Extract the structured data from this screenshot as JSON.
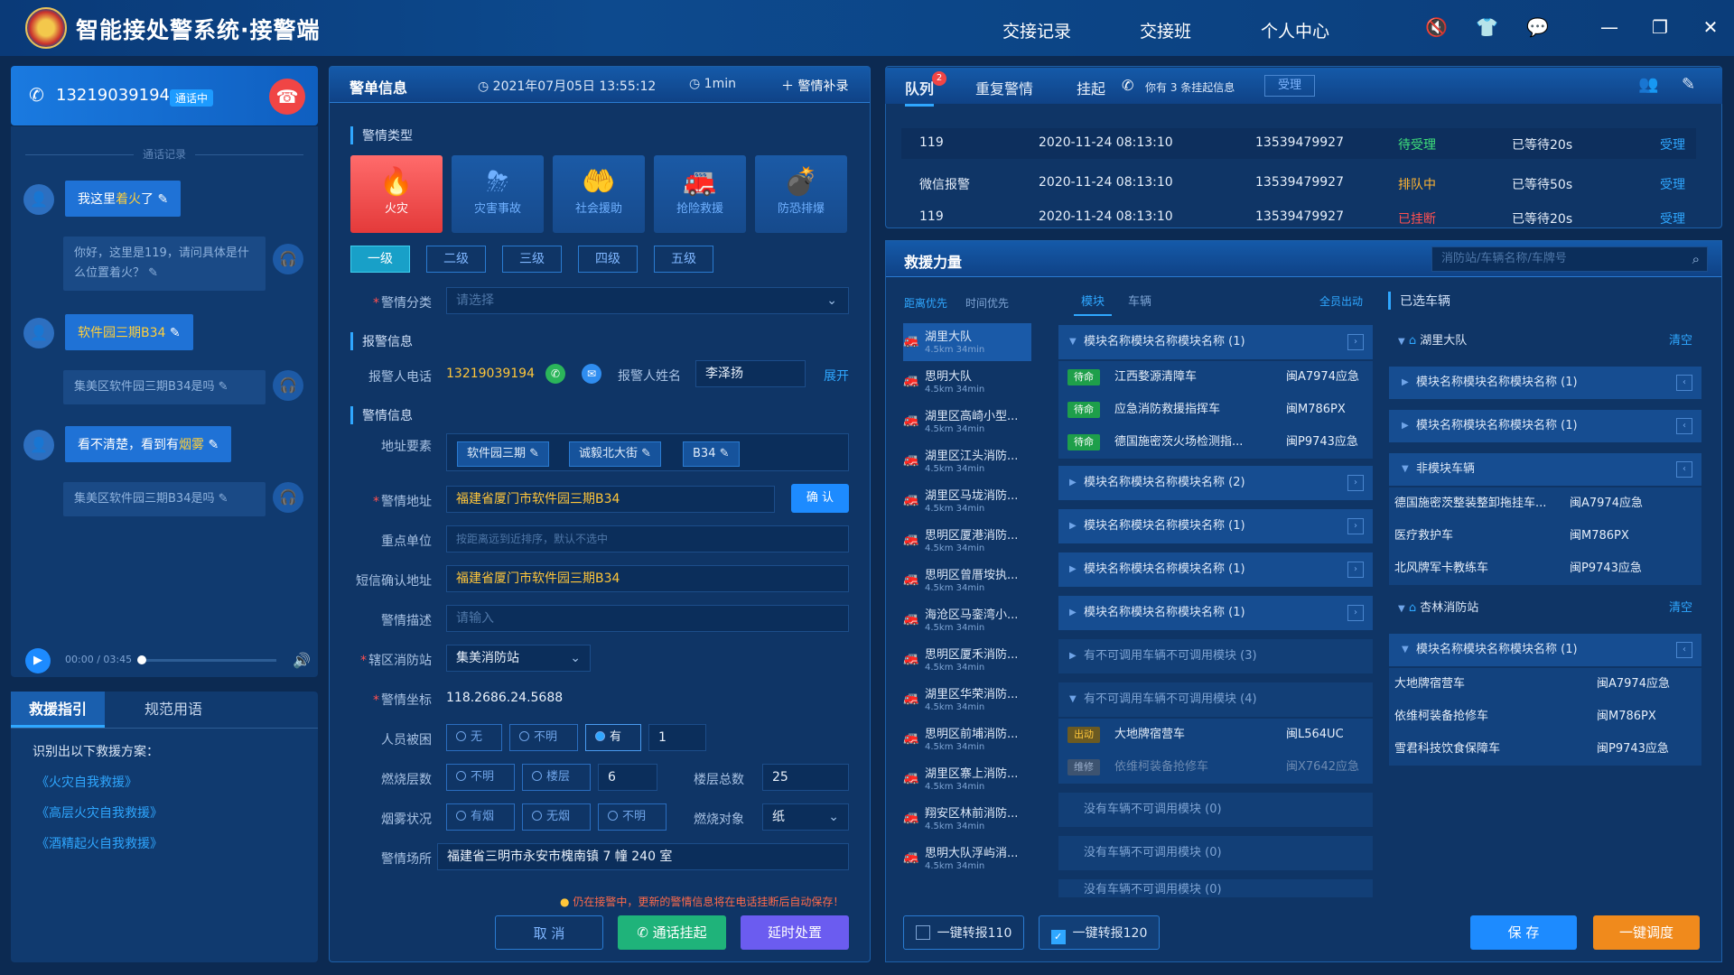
{
  "app": {
    "title": "智能接处警系统·接警端",
    "nav": [
      "交接记录",
      "交接班",
      "个人中心"
    ]
  },
  "call": {
    "phone": "13219039194",
    "status": "通话中",
    "history_label": "通话记录",
    "time": "00:00 / 03:45",
    "messages": [
      {
        "pre": "我这里",
        "hl": "着火",
        "post": "了"
      },
      {
        "text": "你好，这里是119，请问具体是什么位置着火？"
      },
      {
        "pre": "",
        "hl": "软件园三期B34",
        "post": ""
      },
      {
        "text": "集美区软件园三期B34是吗"
      },
      {
        "pre": "看不清楚，看到有",
        "hl": "烟雾",
        "post": ""
      },
      {
        "text": "集美区软件园三期B34是吗"
      }
    ]
  },
  "guide": {
    "tabs": [
      "救援指引",
      "规范用语"
    ],
    "intro": "识别出以下救援方案：",
    "items": [
      "《火灾自我救援》",
      "《高层火灾自我救援》",
      "《酒精起火自我救援》"
    ]
  },
  "form": {
    "title": "警单信息",
    "datetime": "2021年07月05日 13:55:12",
    "duration": "1min",
    "supplement": "警情补录",
    "sec_type": "警情类型",
    "sec_reporter": "报警信息",
    "sec_info": "警情信息",
    "categories": [
      "火灾",
      "灾害事故",
      "社会援助",
      "抢险救援",
      "防恐排爆"
    ],
    "levels": [
      "一级",
      "二级",
      "三级",
      "四级",
      "五级"
    ],
    "class_label": "警情分类",
    "class_ph": "请选择",
    "reporter_phone_label": "报警人电话",
    "reporter_phone": "13219039194",
    "reporter_name_label": "报警人姓名",
    "reporter_name": "李泽扬",
    "expand": "展开",
    "addr_elem_label": "地址要素",
    "addr_tags": [
      "软件园三期",
      "诚毅北大街",
      "B34"
    ],
    "addr_label": "警情地址",
    "addr": "福建省厦门市软件园三期B34",
    "confirm": "确 认",
    "key_unit_label": "重点单位",
    "key_unit_ph": "按距离远到近排序，默认不选中",
    "sms_label": "短信确认地址",
    "sms": "福建省厦门市软件园三期B34",
    "desc_label": "警情描述",
    "desc_ph": "请输入",
    "station_label": "辖区消防站",
    "station": "集美消防站",
    "coord_label": "警情坐标",
    "coord": "118.2686.24.5688",
    "trapped_label": "人员被困",
    "trapped_opts": [
      "无",
      "不明",
      "有"
    ],
    "trapped_count": "1",
    "floor_label": "燃烧层数",
    "floor_opts": [
      "不明",
      "楼层"
    ],
    "floor_val": "6",
    "total_label": "楼层总数",
    "total_val": "25",
    "smoke_label": "烟雾状况",
    "smoke_opts": [
      "有烟",
      "无烟",
      "不明"
    ],
    "burn_label": "燃烧对象",
    "burn_val": "纸",
    "place_label": "警情场所",
    "place": "福建省三明市永安市槐南镇 7 幢 240 室",
    "warning": "仍在接警中，更新的警情信息将在电话挂断后自动保存！",
    "btn_cancel": "取 消",
    "btn_hold": "通话挂起",
    "btn_delay": "延时处置"
  },
  "queue": {
    "tabs": [
      "队列",
      "重复警情",
      "挂起"
    ],
    "badge": "2",
    "hold_info": "你有 3 条挂起信息",
    "accept": "受理",
    "rows": [
      {
        "src": "119",
        "time": "2020-11-24 08:13:10",
        "phone": "13539479927",
        "status": "待受理",
        "wait": "已等待20s",
        "act": "受理",
        "color": "#3fe07a"
      },
      {
        "src": "微信报警",
        "time": "2020-11-24 08:13:10",
        "phone": "13539479927",
        "status": "排队中",
        "wait": "已等待50s",
        "act": "受理",
        "color": "#ffb432"
      },
      {
        "src": "119",
        "time": "2020-11-24 08:13:10",
        "phone": "13539479927",
        "status": "已挂断",
        "wait": "已等待20s",
        "act": "受理",
        "color": "#ff5050"
      }
    ]
  },
  "rescue": {
    "title": "救援力量",
    "search_ph": "消防站/车辆名称/车牌号",
    "sort": [
      "距离优先",
      "时间优先"
    ],
    "tabs": [
      "模块",
      "车辆"
    ],
    "all_out": "全员出动",
    "selected": "已选车辆",
    "stations": [
      {
        "name": "湖里大队",
        "info": "4.5km  34min"
      },
      {
        "name": "思明大队",
        "info": "4.5km  34min"
      },
      {
        "name": "湖里区高崎小型...",
        "info": "4.5km  34min"
      },
      {
        "name": "湖里区江头消防...",
        "info": "4.5km  34min"
      },
      {
        "name": "湖里区马垅消防...",
        "info": "4.5km  34min"
      },
      {
        "name": "思明区厦港消防...",
        "info": "4.5km  34min"
      },
      {
        "name": "思明区曾厝垵执...",
        "info": "4.5km  34min"
      },
      {
        "name": "海沧区马銮湾小...",
        "info": "4.5km  34min"
      },
      {
        "name": "思明区厦禾消防...",
        "info": "4.5km  34min"
      },
      {
        "name": "湖里区华荣消防...",
        "info": "4.5km  34min"
      },
      {
        "name": "思明区前埔消防...",
        "info": "4.5km  34min"
      },
      {
        "name": "湖里区寨上消防...",
        "info": "4.5km  34min"
      },
      {
        "name": "翔安区林前消防...",
        "info": "4.5km  34min"
      },
      {
        "name": "思明大队浮屿消...",
        "info": "4.5km  34min"
      }
    ],
    "modules": [
      {
        "name": "模块名称模块名称模块名称 (1)"
      },
      {
        "name": "模块名称模块名称模块名称 (2)"
      },
      {
        "name": "模块名称模块名称模块名称 (1)"
      },
      {
        "name": "模块名称模块名称模块名称 (1)"
      },
      {
        "name": "模块名称模块名称模块名称 (1)"
      }
    ],
    "vehicles": [
      {
        "badge": "待命",
        "name": "江西婺源清障车",
        "plate": "闽A7974应急"
      },
      {
        "badge": "待命",
        "name": "应急消防救援指挥车",
        "plate": "闽M786PX"
      },
      {
        "badge": "待命",
        "name": "德国施密茨火场检测指...",
        "plate": "闽P9743应急"
      }
    ],
    "unavail1": "有不可调用车辆不可调用模块 (3)",
    "unavail2": "有不可调用车辆不可调用模块 (4)",
    "uveh": [
      {
        "badge": "出动",
        "name": "大地牌宿营车",
        "plate": "闽L564UC"
      },
      {
        "badge": "维修",
        "name": "依维柯装备抢修车",
        "plate": "闽X7642应急"
      }
    ],
    "none": [
      "没有车辆不可调用模块 (0)",
      "没有车辆不可调用模块 (0)",
      "没有车辆不可调用模块 (0)"
    ],
    "transfer110": "一键转报110",
    "transfer120": "一键转报120",
    "save": "保 存",
    "dispatch": "一键调度",
    "sel_groups": [
      {
        "station": "湖里大队",
        "clear": "清空",
        "mods": [
          "模块名称模块名称模块名称 (1)",
          "模块名称模块名称模块名称 (1)"
        ],
        "nonmod": "非模块车辆",
        "vehs": [
          {
            "name": "德国施密茨整装整卸拖挂车...",
            "plate": "闽A7974应急"
          },
          {
            "name": "医疗救护车",
            "plate": "闽M786PX"
          },
          {
            "name": "北风牌军卡教练车",
            "plate": "闽P9743应急"
          }
        ]
      },
      {
        "station": "杏林消防站",
        "clear": "清空",
        "mods": [
          "模块名称模块名称模块名称 (1)"
        ],
        "vehs": [
          {
            "name": "大地牌宿营车",
            "plate": "闽A7974应急"
          },
          {
            "name": "依维柯装备抢修车",
            "plate": "闽M786PX"
          },
          {
            "name": "雪君科技饮食保障车",
            "plate": "闽P9743应急"
          }
        ]
      }
    ]
  }
}
